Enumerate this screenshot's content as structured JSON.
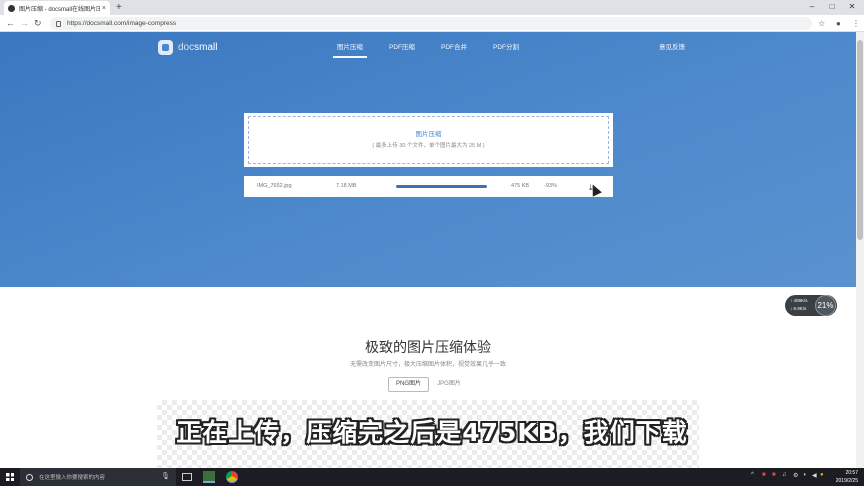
{
  "browser": {
    "tab_title": "图片压缩 - docsmall在线图片压",
    "url": "https://docsmall.com/image-compress",
    "new_tab_symbol": "+",
    "tab_close_symbol": "×",
    "controls": {
      "minimize": "–",
      "maximize": "□",
      "close": "✕"
    },
    "nav": {
      "back": "←",
      "forward": "→",
      "reload": "↻"
    },
    "star_symbol": "☆",
    "menu_symbol": "⋮"
  },
  "site": {
    "logo_prefix": "doc",
    "logo_suffix": "small",
    "nav_items": [
      {
        "label": "图片压缩",
        "active": true
      },
      {
        "label": "PDF压缩",
        "active": false
      },
      {
        "label": "PDF合并",
        "active": false
      },
      {
        "label": "PDF分割",
        "active": false
      }
    ],
    "feedback_label": "意见反馈"
  },
  "upload": {
    "title": "图片压缩",
    "subtitle": "( 最多上传 30 个文件，单个图片最大为 25 M )"
  },
  "file": {
    "name": "IMG_7652.jpg",
    "original_size": "7.18 MB",
    "progress_fraction": 1.0,
    "compressed_size": "475 KB",
    "reduction": "-93%",
    "download_icon": "download-icon"
  },
  "section": {
    "title": "极致的图片压缩体验",
    "subtitle": "无需改变图片尺寸，极大压缩图片体积，视觉效果几乎一致",
    "tabs": [
      {
        "label": "PNG图片",
        "active": true
      },
      {
        "label": "JPG图片",
        "active": false
      }
    ]
  },
  "caption": "正在上传，压缩完之后是475KB，我们下载",
  "speed_widget": {
    "up": "↑ 409K/s",
    "down": "↓ 6.9K/s",
    "percent": "21%"
  },
  "taskbar": {
    "search_placeholder": "在这里输入你要搜索的内容",
    "time": "20:57",
    "date": "2019/2/25"
  },
  "colors": {
    "hero_blue": "#4a86c9",
    "progress_blue": "#3d72b3",
    "taskbar": "#1b1d23"
  }
}
